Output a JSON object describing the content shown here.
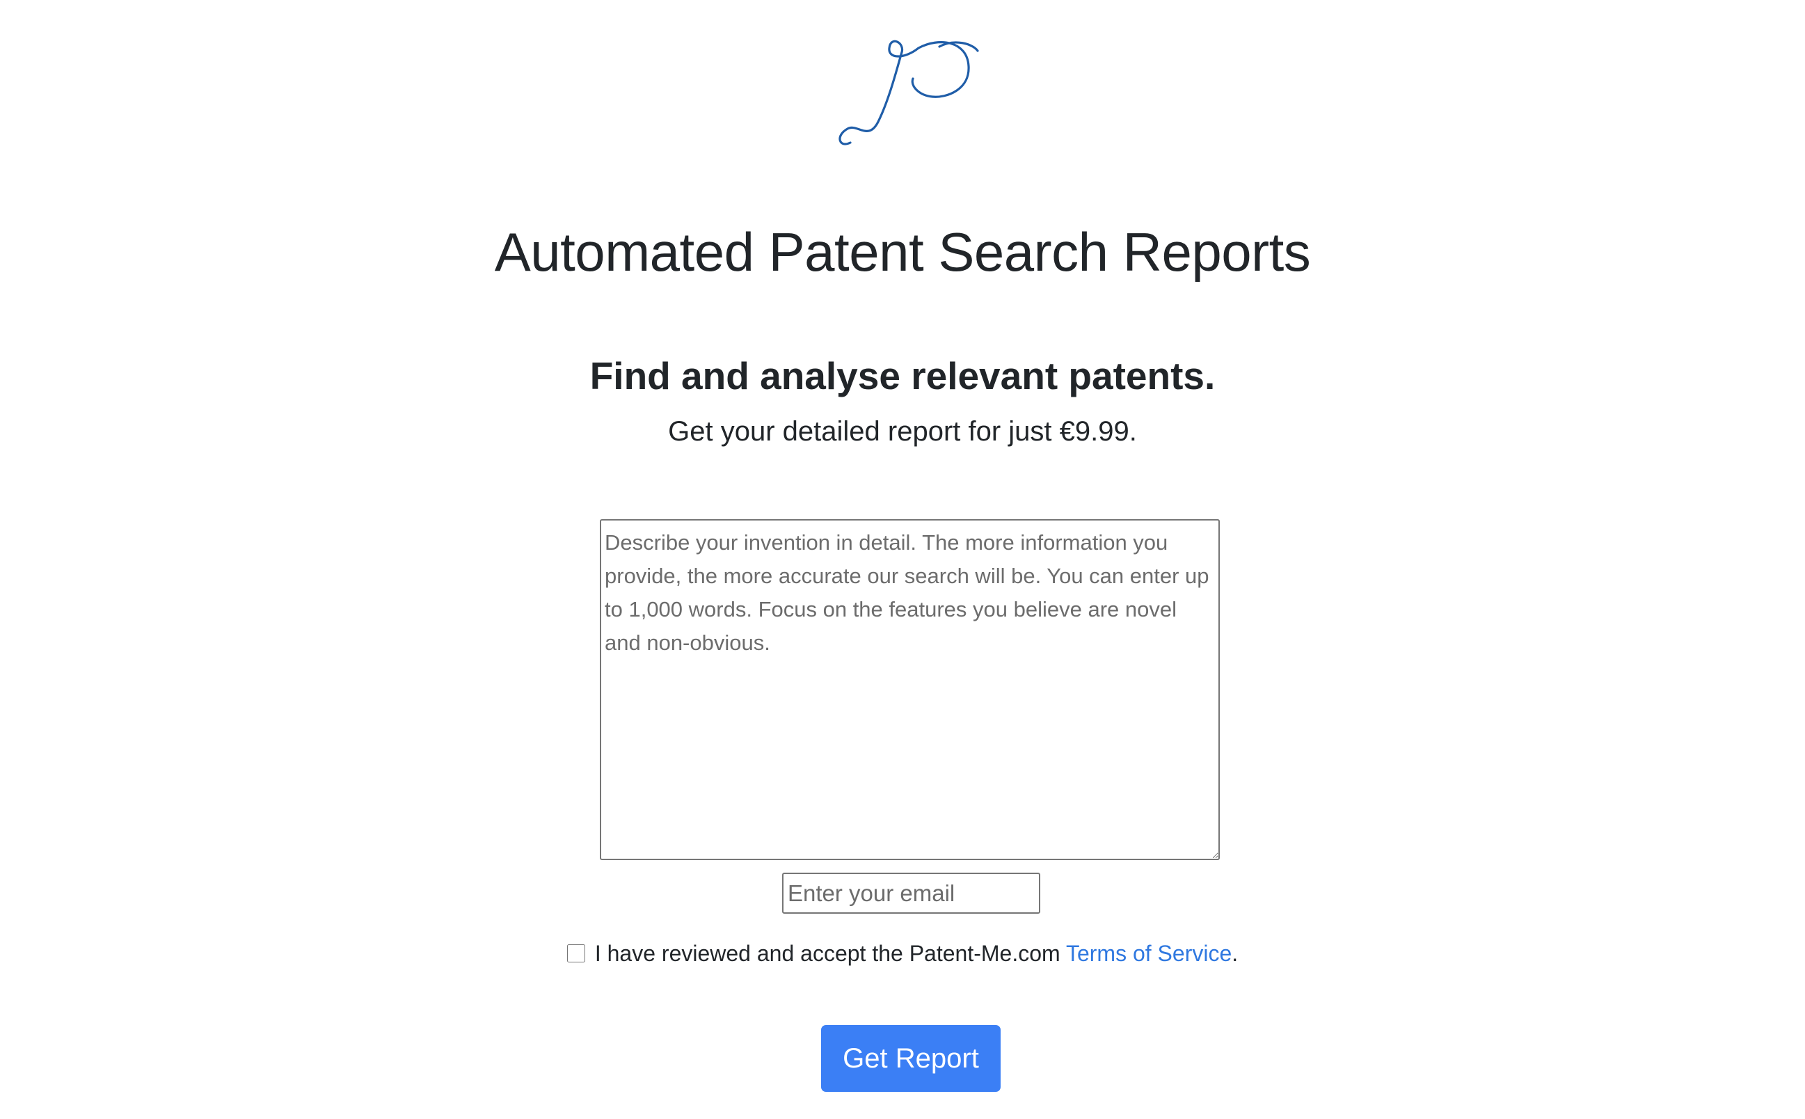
{
  "brand": {
    "logo_icon": "cursive-p-logo",
    "logo_color": "#1f5da8"
  },
  "hero": {
    "title": "Automated Patent Search Reports",
    "subtitle": "Find and analyse relevant patents.",
    "lead": "Get your detailed report for just €9.99."
  },
  "form": {
    "invention_placeholder": "Describe your invention in detail. The more information you provide, the more accurate our search will be. You can enter up to 1,000 words. Focus on the features you believe are novel and non-obvious.",
    "invention_value": "",
    "email_placeholder": "Enter your email",
    "email_value": "",
    "tos_checked": false,
    "tos_text": "I have reviewed and accept the Patent-Me.com ",
    "tos_link_text": "Terms of Service",
    "tos_suffix": ".",
    "submit_label": "Get Report"
  },
  "colors": {
    "text": "#212529",
    "link": "#2f78e0",
    "button": "#3b7ff5",
    "button_text": "#ffffff"
  }
}
